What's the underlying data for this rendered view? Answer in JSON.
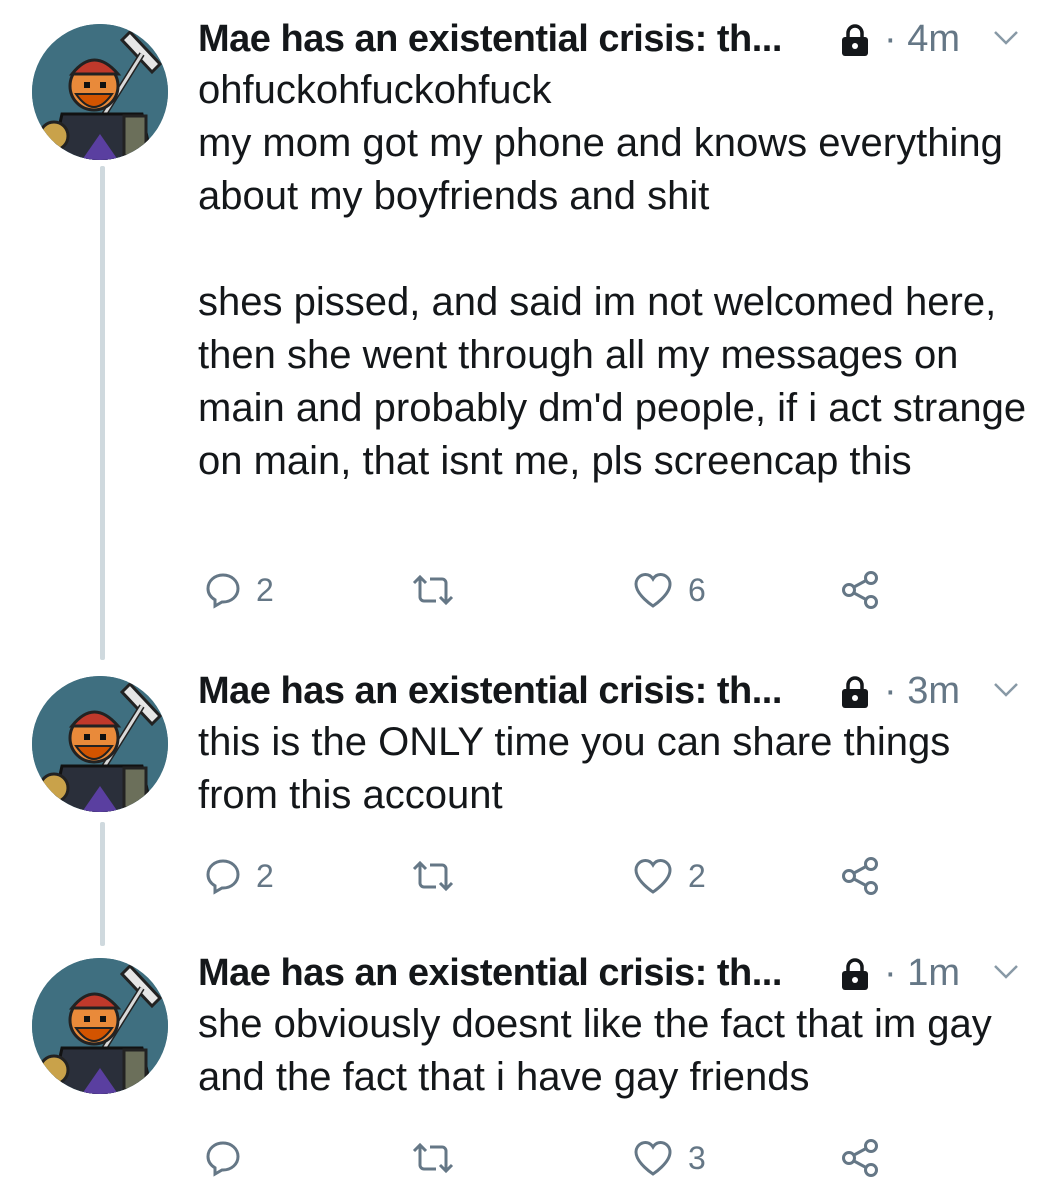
{
  "colors": {
    "text": "#14171a",
    "muted": "#657786",
    "thread_line": "#cfd9de"
  },
  "tweets": [
    {
      "name": "Mae has an existential crisis: th...",
      "protected_icon": "lock-icon",
      "time": "· 4m",
      "menu_icon": "chevron-down-icon",
      "paragraphs": [
        "ohfuckohfuckohfuck\nmy mom got my phone and knows everything about my boyfriends and shit",
        "shes pissed, and said im not welcomed here, then she went through all my messages on main and probably dm'd people, if i act strange on main, that isnt me, pls screencap this"
      ],
      "replies": "2",
      "retweets": "",
      "likes": "6"
    },
    {
      "name": "Mae has an existential crisis: th...",
      "protected_icon": "lock-icon",
      "time": "· 3m",
      "menu_icon": "chevron-down-icon",
      "paragraphs": [
        "this is the ONLY time you can share things from this account"
      ],
      "replies": "2",
      "retweets": "",
      "likes": "2"
    },
    {
      "name": "Mae has an existential crisis: th...",
      "protected_icon": "lock-icon",
      "time": "· 1m",
      "menu_icon": "chevron-down-icon",
      "paragraphs": [
        "she obviously doesnt like the fact that im gay and the fact that i have gay friends"
      ],
      "replies": "",
      "retweets": "",
      "likes": "3"
    }
  ]
}
